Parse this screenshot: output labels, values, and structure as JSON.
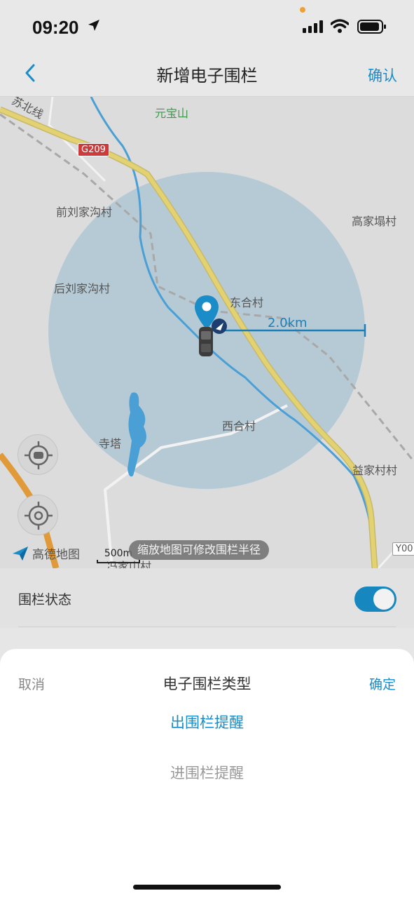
{
  "status_bar": {
    "time": "09:20"
  },
  "nav": {
    "title": "新增电子围栏",
    "confirm": "确认"
  },
  "map": {
    "labels": {
      "railway": "苏北线",
      "mountain": "元宝山",
      "road_g209": "G209",
      "village_1": "前刘家沟村",
      "village_2": "后刘家沟村",
      "village_3": "高家塌村",
      "village_4": "东合村",
      "village_5": "西合村",
      "village_6": "寺塔",
      "village_7": "益家村村",
      "village_8": "冯家山村",
      "road_right": "Y00"
    },
    "radius": "2.0km",
    "logo": "高德地图",
    "scale": "500m",
    "tip": "缩放地图可修改围栏半径"
  },
  "fence_status": {
    "label": "围栏状态",
    "enabled": true
  },
  "sheet": {
    "cancel": "取消",
    "title": "电子围栏类型",
    "ok": "确定",
    "options": [
      "出围栏提醒",
      "进围栏提醒"
    ],
    "selected_index": 0
  },
  "colors": {
    "accent": "#1a8cc8",
    "toggle_on": "#1687bf",
    "fence_circle": "#a9c4d4"
  }
}
